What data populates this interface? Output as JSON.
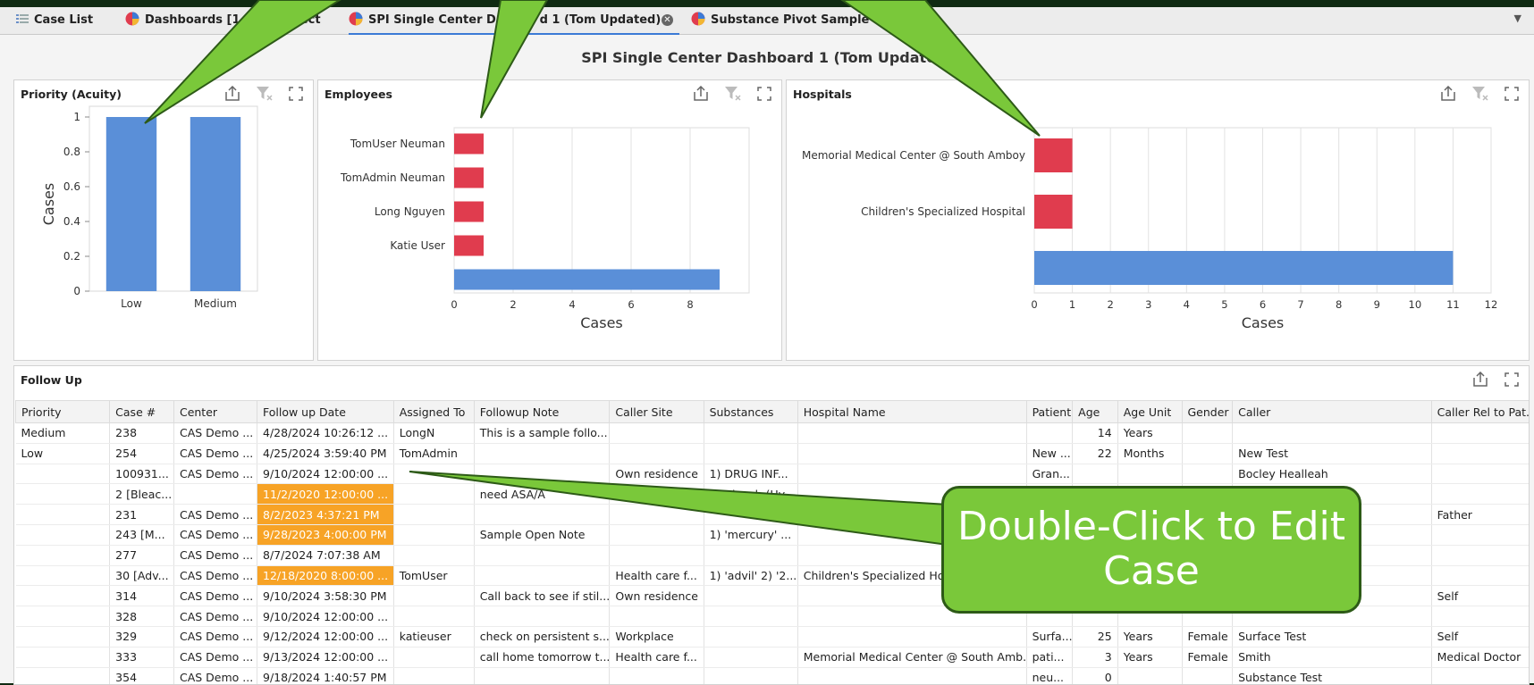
{
  "tabs": [
    {
      "label": "Case List",
      "icon": "list-icon"
    },
    {
      "label": "Dashboards [1 of 31 select",
      "icon": "dashboard-icon"
    },
    {
      "label": "SPI Single Center Da",
      "suffix": "d 1 (Tom Updated)",
      "icon": "dashboard-icon"
    },
    {
      "label": "Substance Pivot Sample",
      "icon": "dashboard-icon"
    }
  ],
  "dashboard_title": "SPI Single Center Dashboard 1 (Tom Updated)",
  "panels": {
    "priority": {
      "title": "Priority (Acuity)"
    },
    "employees": {
      "title": "Employees"
    },
    "hospitals": {
      "title": "Hospitals"
    },
    "followup": {
      "title": "Follow Up"
    }
  },
  "chart_data": [
    {
      "type": "bar",
      "title": "Priority (Acuity)",
      "categories": [
        "Low",
        "Medium"
      ],
      "values": [
        1,
        1
      ],
      "ylabel": "Cases",
      "ylim": [
        0,
        1
      ],
      "yticks": [
        "0",
        "0.2",
        "0.4",
        "0.6",
        "0.8",
        "1"
      ],
      "grid": false,
      "colors": [
        "#5a8fd8"
      ]
    },
    {
      "type": "bar",
      "orientation": "horizontal",
      "title": "Employees",
      "categories": [
        "TomUser Neuman",
        "TomAdmin Neuman",
        "Long Nguyen",
        "Katie User",
        ""
      ],
      "values": [
        1,
        1,
        1,
        1,
        9
      ],
      "xlabel": "Cases",
      "xlim": [
        0,
        10
      ],
      "xticks": [
        "0",
        "2",
        "4",
        "6",
        "8"
      ],
      "grid": true,
      "colors": [
        "#e03c4e",
        "#e03c4e",
        "#e03c4e",
        "#e03c4e",
        "#5a8fd8"
      ]
    },
    {
      "type": "bar",
      "orientation": "horizontal",
      "title": "Hospitals",
      "categories": [
        "Memorial Medical Center @ South Amboy",
        "Children's Specialized Hospital",
        ""
      ],
      "values": [
        1,
        1,
        11
      ],
      "xlabel": "Cases",
      "xlim": [
        0,
        12
      ],
      "xticks": [
        "0",
        "1",
        "2",
        "3",
        "4",
        "5",
        "6",
        "7",
        "8",
        "9",
        "10",
        "11",
        "12"
      ],
      "grid": true,
      "colors": [
        "#e03c4e",
        "#e03c4e",
        "#5a8fd8"
      ]
    }
  ],
  "followup": {
    "columns": [
      "Priority",
      "Case #",
      "Center",
      "Follow up Date",
      "Assigned To",
      "Followup Note",
      "Caller Site",
      "Substances",
      "Hospital Name",
      "Patient",
      "Age",
      "Age Unit",
      "Gender",
      "Caller",
      "Caller Rel to Pat..."
    ],
    "rows": [
      [
        "Medium",
        "238",
        "CAS Demo ...",
        "4/28/2024 10:26:12 ...",
        "LongN",
        "This is a sample follo...",
        "",
        "",
        "",
        "",
        "14",
        "Years",
        "",
        "",
        ""
      ],
      [
        "Low",
        "254",
        "CAS Demo ...",
        "4/25/2024 3:59:40 PM",
        "TomAdmin",
        "",
        "",
        "",
        "",
        "New ...",
        "22",
        "Months",
        "",
        "New Test",
        ""
      ],
      [
        "",
        "100931...",
        "CAS Demo ...",
        "9/10/2024 12:00:00 ...",
        "",
        "",
        "Own residence",
        "1) DRUG INF...",
        "",
        "Gran...",
        "",
        "",
        "",
        "Bocley Healleah",
        ""
      ],
      [
        "",
        "2 [Bleac...",
        "",
        "11/2/2020 12:00:00 ...",
        "",
        "need ASA/A",
        "",
        "1) Bleach (Hy...",
        "",
        "",
        "",
        "",
        "",
        "",
        ""
      ],
      [
        "",
        "231",
        "CAS Demo ...",
        "8/2/2023 4:37:21 PM",
        "",
        "",
        "",
        "",
        "",
        "",
        "",
        "",
        "",
        "",
        "Father"
      ],
      [
        "",
        "243 [M...",
        "CAS Demo ...",
        "9/28/2023 4:00:00 PM",
        "",
        "Sample Open Note",
        "",
        "1) 'mercury' ...",
        "",
        "",
        "",
        "",
        "",
        "",
        ""
      ],
      [
        "",
        "277",
        "CAS Demo ...",
        "8/7/2024 7:07:38 AM",
        "",
        "",
        "",
        "",
        "",
        "",
        "",
        "",
        "",
        "",
        ""
      ],
      [
        "",
        "30 [Adv...",
        "CAS Demo ...",
        "12/18/2020 8:00:00 ...",
        "TomUser",
        "",
        "Health care f...",
        "1) 'advil' 2) '2...",
        "Children's Specialized Hospita",
        "",
        "",
        "",
        "",
        "",
        ""
      ],
      [
        "",
        "314",
        "CAS Demo ...",
        "9/10/2024 3:58:30 PM",
        "",
        "Call back to see if stil...",
        "Own residence",
        "",
        "",
        "",
        "",
        "",
        "",
        "",
        "Self"
      ],
      [
        "",
        "328",
        "CAS Demo ...",
        "9/10/2024 12:00:00 ...",
        "",
        "",
        "",
        "",
        "",
        "",
        "",
        "",
        "",
        "",
        ""
      ],
      [
        "",
        "329",
        "CAS Demo ...",
        "9/12/2024 12:00:00 ...",
        "katieuser",
        "check on persistent s...",
        "Workplace",
        "",
        "",
        "Surfa...",
        "25",
        "Years",
        "Female",
        "Surface Test",
        "Self"
      ],
      [
        "",
        "333",
        "CAS Demo ...",
        "9/13/2024 12:00:00 ...",
        "",
        "call home tomorrow t...",
        "Health care f...",
        "",
        "Memorial Medical Center @ South Amb...",
        "pati...",
        "3",
        "Years",
        "Female",
        " Smith",
        "Medical Doctor"
      ],
      [
        "",
        "354",
        "CAS Demo ...",
        "9/18/2024 1:40:57 PM",
        "",
        "",
        "",
        "",
        "",
        "neu...",
        "0",
        "",
        "",
        "Substance Test",
        ""
      ]
    ],
    "highlighted_rows": [
      3,
      4,
      5,
      7
    ],
    "highlight_color": "#f7a326"
  },
  "callout": {
    "text": "Double-Click to Edit Case",
    "color": "#7ac83a"
  }
}
